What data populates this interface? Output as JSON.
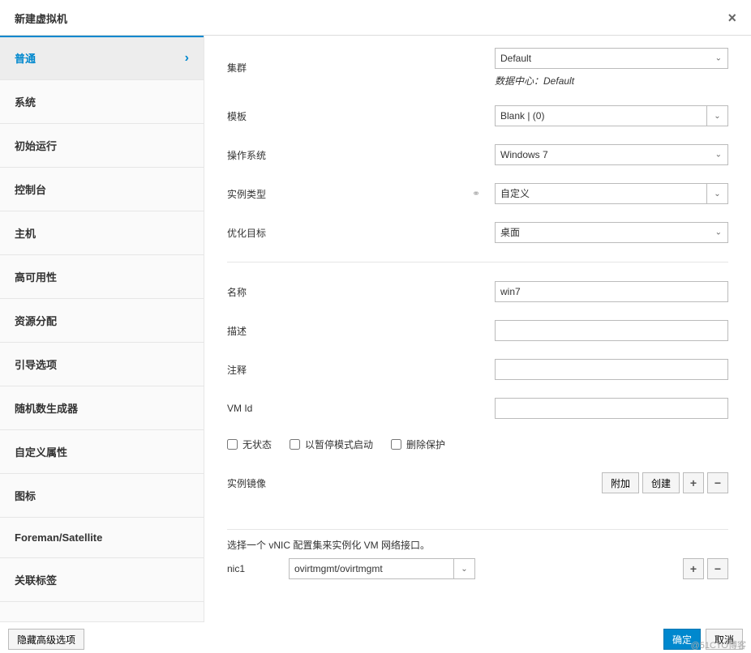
{
  "dialog": {
    "title": "新建虚拟机",
    "close": "×"
  },
  "sidebar": {
    "items": [
      {
        "label": "普通",
        "active": true
      },
      {
        "label": "系统"
      },
      {
        "label": "初始运行"
      },
      {
        "label": "控制台"
      },
      {
        "label": "主机"
      },
      {
        "label": "高可用性"
      },
      {
        "label": "资源分配"
      },
      {
        "label": "引导选项"
      },
      {
        "label": "随机数生成器"
      },
      {
        "label": "自定义属性"
      },
      {
        "label": "图标"
      },
      {
        "label": "Foreman/Satellite"
      },
      {
        "label": "关联标签"
      }
    ]
  },
  "form": {
    "cluster": {
      "label": "集群",
      "value": "Default",
      "note_prefix": "数据中心：",
      "note_value": "Default"
    },
    "template": {
      "label": "模板",
      "value": "Blank |  (0)"
    },
    "os": {
      "label": "操作系统",
      "value": "Windows 7"
    },
    "instance_type": {
      "label": "实例类型",
      "value": "自定义"
    },
    "optimization": {
      "label": "优化目标",
      "value": "桌面"
    },
    "name": {
      "label": "名称",
      "value": "win7"
    },
    "description": {
      "label": "描述",
      "value": ""
    },
    "comment": {
      "label": "注释",
      "value": ""
    },
    "vmid": {
      "label": "VM Id",
      "value": ""
    },
    "checkboxes": {
      "stateless": "无状态",
      "start_paused": "以暂停模式启动",
      "delete_protect": "删除保护"
    },
    "instance_image": {
      "label": "实例镜像",
      "attach": "附加",
      "create": "创建"
    },
    "vnic": {
      "hint": "选择一个 vNIC 配置集来实例化 VM 网络接口。",
      "nic_label": "nic1",
      "value": "ovirtmgmt/ovirtmgmt"
    }
  },
  "footer": {
    "hide_advanced": "隐藏高级选项",
    "ok": "确定",
    "cancel": "取消"
  },
  "watermark": "@51CTO博客"
}
